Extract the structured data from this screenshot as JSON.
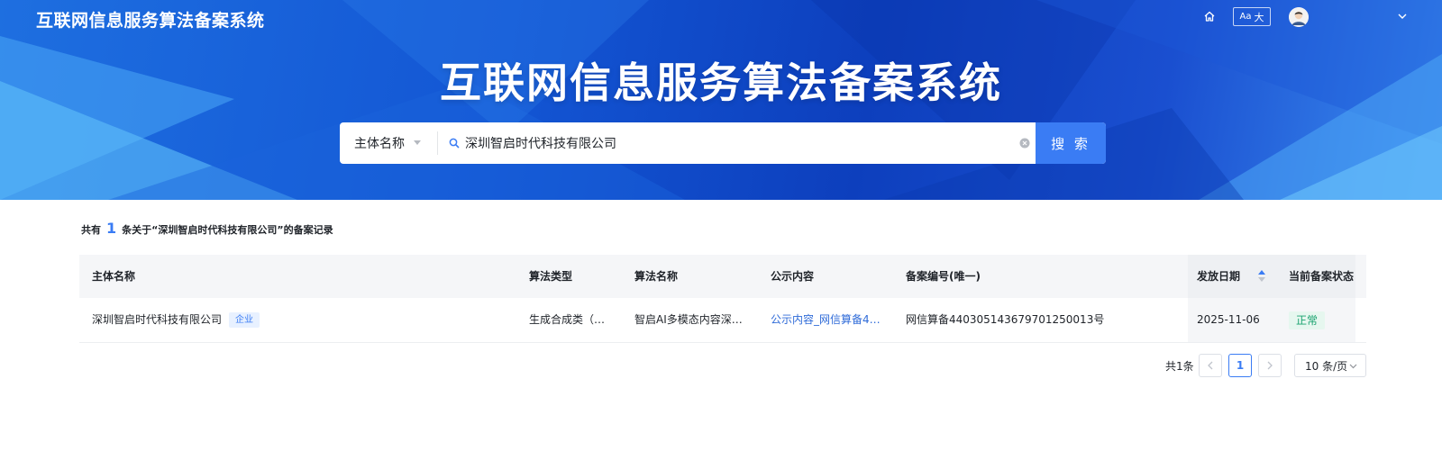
{
  "header": {
    "site_title": "互联网信息服务算法备案系统",
    "font_toggle_small": "Aa",
    "font_toggle_large": "大"
  },
  "hero": {
    "title": "互联网信息服务算法备案系统"
  },
  "search": {
    "type_selected": "主体名称",
    "query": "深圳智启时代科技有限公司",
    "button_label": "搜 索"
  },
  "results": {
    "prefix": "共有",
    "count": "1",
    "suffix": "条关于“深圳智启时代科技有限公司”的备案记录"
  },
  "table": {
    "columns": [
      "主体名称",
      "算法类型",
      "算法名称",
      "公示内容",
      "备案编号(唯一)",
      "发放日期",
      "当前备案状态"
    ],
    "rows": [
      {
        "entity": "深圳智启时代科技有限公司",
        "entity_tag": "企业",
        "algo_type": "生成合成类（…",
        "algo_name": "智启AI多模态内容深…",
        "public_content": "公示内容_网信算备4…",
        "filing_no": "网信算备440305143679701250013号",
        "issue_date": "2025-11-06",
        "status": "正常"
      }
    ]
  },
  "pagination": {
    "total": "共1条",
    "current_page": "1",
    "page_size": "10 条/页"
  },
  "colors": {
    "accent": "#3a7cf4",
    "status_ok": "#1aa36f",
    "banner_dark": "#0d3fbd"
  },
  "icons": {
    "home": "home-icon",
    "avatar": "user-avatar",
    "chevron": "chevron-down-icon",
    "search": "search-icon",
    "clear": "clear-icon",
    "sort": "sort-icon"
  }
}
